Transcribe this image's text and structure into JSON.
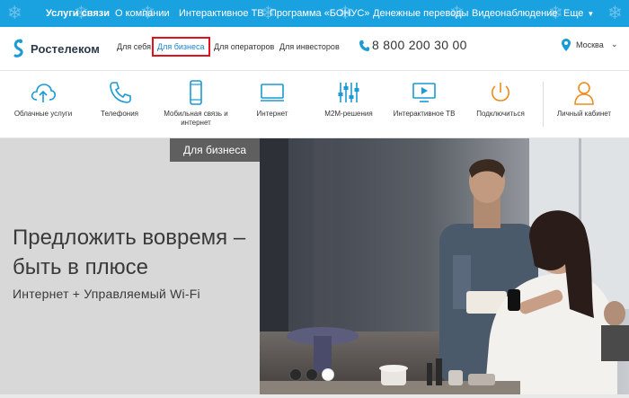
{
  "topnav": {
    "items": [
      {
        "label": "Услуги связи",
        "active": true
      },
      {
        "label": "О компании",
        "active": false
      },
      {
        "label": "Интерактивное ТВ",
        "active": false
      },
      {
        "label": "Программа «БОНУС»",
        "active": false
      },
      {
        "label": "Денежные переводы",
        "active": false
      },
      {
        "label": "Видеонаблюдение",
        "active": false
      }
    ],
    "more_label": "Еще",
    "bg_color": "#1aa1e0"
  },
  "header": {
    "logo_text": "Ростелеком",
    "segments": [
      {
        "label": "Для себя",
        "active": false
      },
      {
        "label": "Для бизнеса",
        "active": true
      },
      {
        "label": "Для операторов",
        "active": false
      },
      {
        "label": "Для инвесторов",
        "active": false
      }
    ],
    "phone": "8 800 200 30 00",
    "city": "Москва",
    "highlight_color": "#e3111b"
  },
  "services": [
    {
      "label": "Облачные услуги",
      "icon": "cloud-upload-icon"
    },
    {
      "label": "Телефония",
      "icon": "phone-handset-icon"
    },
    {
      "label": "Мобильная связь и интернет",
      "icon": "mobile-phone-icon"
    },
    {
      "label": "Интернет",
      "icon": "monitor-icon"
    },
    {
      "label": "M2M-решения",
      "icon": "sliders-icon"
    },
    {
      "label": "Интерактивное ТВ",
      "icon": "tv-play-icon"
    },
    {
      "label": "Подключиться",
      "icon": "power-icon"
    },
    {
      "label": "Личный кабинет",
      "icon": "user-icon"
    }
  ],
  "hero": {
    "tag": "Для бизнеса",
    "title_line1": "Предложить вовремя –",
    "title_line2": "быть в плюсе",
    "subtitle": "Интернет + Управляемый Wi-Fi",
    "slides_total": 3,
    "slide_active": 3
  },
  "colors": {
    "accent": "#1aa1e0",
    "icon_blue": "#1a9ad6",
    "icon_orange": "#f08a1c",
    "hero_bg": "#d8d8d8"
  }
}
